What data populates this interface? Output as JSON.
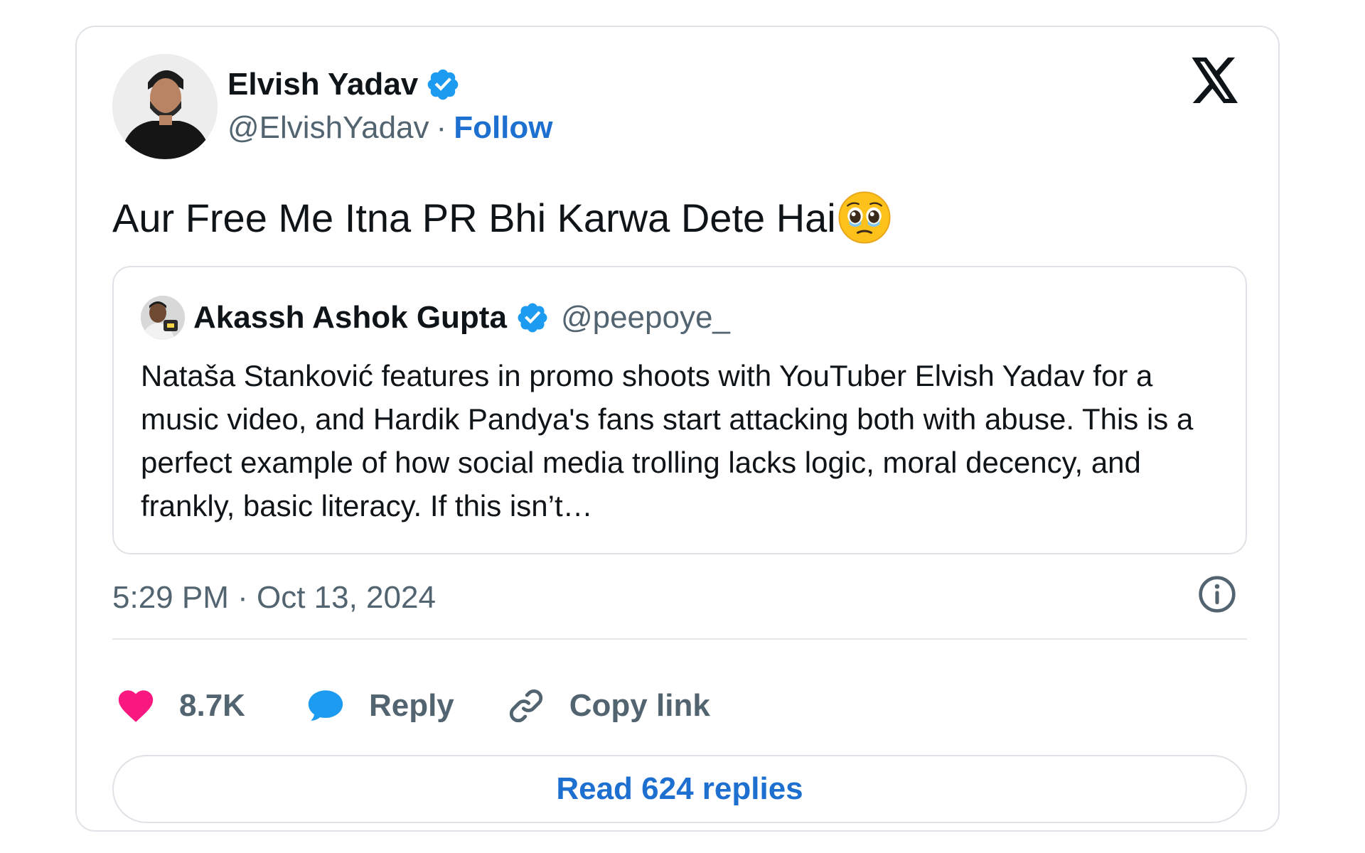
{
  "tweet": {
    "author": {
      "display_name": "Elvish Yadav",
      "handle": "@ElvishYadav",
      "verified": true,
      "avatar_icon": "person-avatar"
    },
    "separator": "·",
    "follow_label": "Follow",
    "platform_icon": "x-logo-icon",
    "text": "Aur Free Me Itna PR Bhi Karwa Dete Hai",
    "emoji": "🥹",
    "timestamp": "5:29 PM · Oct 13, 2024",
    "info_icon": "info-icon"
  },
  "quoted_tweet": {
    "author": {
      "display_name": "Akassh Ashok Gupta",
      "handle": "@peepoye_",
      "verified": true,
      "avatar_icon": "person-avatar"
    },
    "text": "Nataša Stanković features in promo shoots with YouTuber Elvish Yadav for a music video, and Hardik Pandya's fans start attacking both with abuse. This is a perfect example of how social media trolling lacks logic, moral decency, and frankly, basic literacy. If this isn’t…"
  },
  "actions": {
    "like": {
      "icon": "heart-icon",
      "label": "8.7K"
    },
    "reply": {
      "icon": "speech-bubble-icon",
      "label": "Reply"
    },
    "copy_link": {
      "icon": "link-icon",
      "label": "Copy link"
    }
  },
  "read_replies_label": "Read 624 replies",
  "colors": {
    "accent_blue": "#1d6fd0",
    "verified_blue": "#1d9bf0",
    "like_pink": "#f91880",
    "muted_text": "#536471",
    "border": "#dfe3e7"
  }
}
